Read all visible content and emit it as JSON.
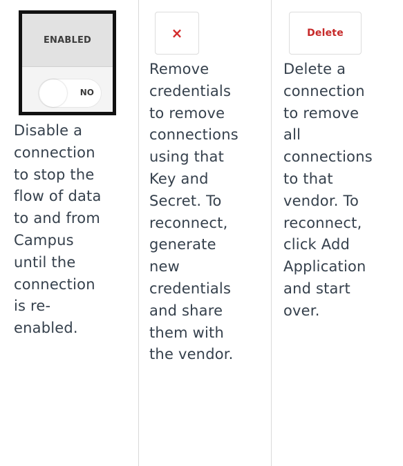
{
  "columns": [
    {
      "widget": {
        "header": "ENABLED",
        "state_label": "NO"
      },
      "description": "Disable a\nconnection\nto stop the\nflow of data\nto and from\nCampus\nuntil the\nconnection\nis re-\nenabled."
    },
    {
      "button": {
        "icon": "close-icon",
        "glyph": "×"
      },
      "description": "Remove\ncredentials\nto remove\nconnections\nusing that\nKey and\nSecret. To\nreconnect,\ngenerate\nnew\ncredentials\nand share\nthem with\nthe vendor."
    },
    {
      "button": {
        "label": "Delete"
      },
      "description": "Delete a\nconnection\nto remove\nall\nconnections\nto that\nvendor. To\nreconnect,\nclick Add\nApplication\nand start\nover."
    }
  ],
  "colors": {
    "text": "#35404c",
    "danger": "#c62828",
    "divider": "#d9d9d9"
  }
}
